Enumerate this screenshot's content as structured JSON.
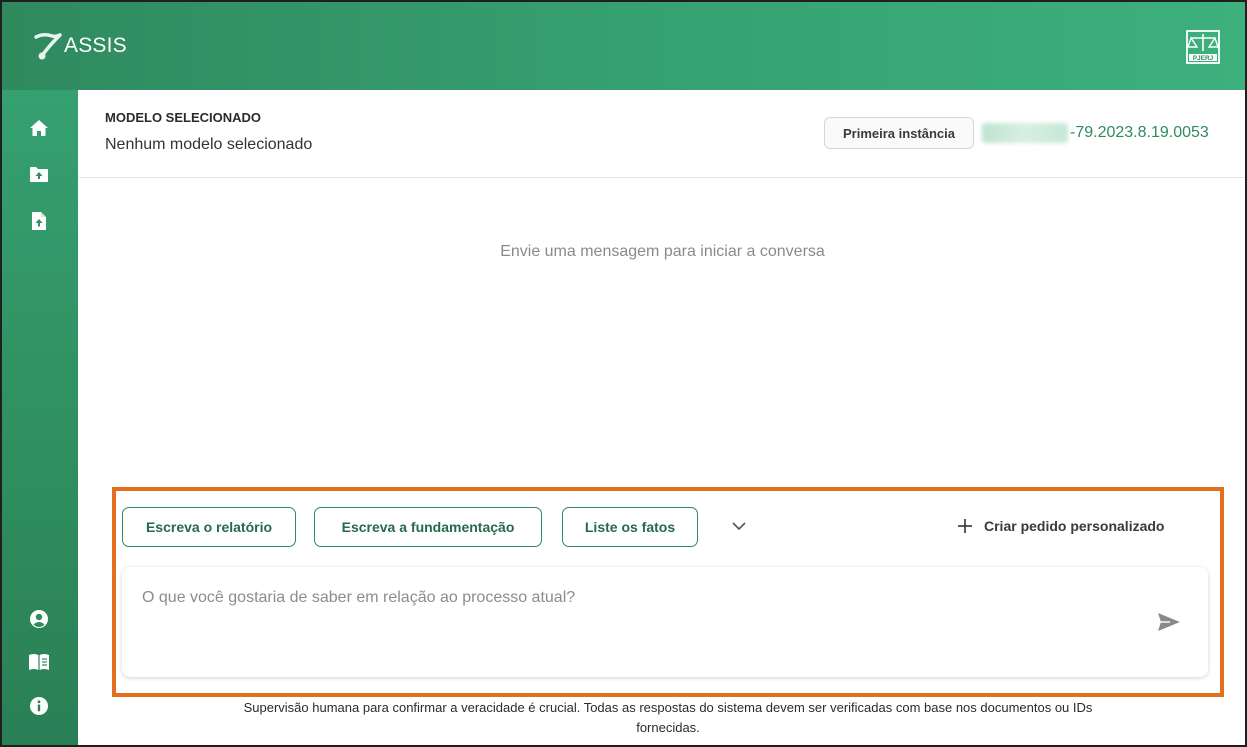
{
  "topbar": {
    "app_name": "ASSIS",
    "brand_icon": "assis-logo-icon",
    "court_logo": "scales-of-justice-icon",
    "court_logo_text": "PJERJ"
  },
  "sidebar": {
    "items": [
      {
        "icon": "home-icon"
      },
      {
        "icon": "folder-upload-icon"
      },
      {
        "icon": "file-upload-icon"
      },
      {
        "icon": "user-circle-icon"
      },
      {
        "icon": "book-icon"
      },
      {
        "icon": "info-icon"
      }
    ]
  },
  "header": {
    "model_label": "MODELO SELECIONADO",
    "model_value": "Nenhum modelo selecionado",
    "instance_label": "Primeira instância",
    "process_number_visible": "-79.2023.8.19.0053"
  },
  "conversation": {
    "empty_message": "Envie uma mensagem para iniciar a conversa"
  },
  "suggestions": [
    {
      "label": "Escreva o relatório"
    },
    {
      "label": "Escreva a fundamentação"
    },
    {
      "label": "Liste os fatos"
    }
  ],
  "custom_request": {
    "label": "Criar pedido personalizado"
  },
  "input": {
    "placeholder": "O que você gostaria de saber em relação ao processo atual?",
    "value": ""
  },
  "disclaimer": {
    "line1": "Supervisão humana para confirmar a veracidade é crucial. Todas as respostas do sistema devem ser verificadas com base nos documentos ou IDs",
    "line2": "fornecidas."
  },
  "colors": {
    "brand_green": "#2f8a5e",
    "highlight_orange": "#e46f1c"
  }
}
